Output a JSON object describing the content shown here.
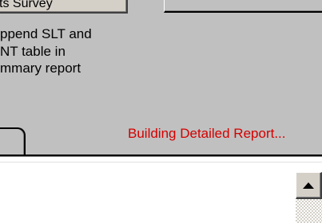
{
  "dialog": {
    "top_button_label": "ts Survey",
    "checkbox_label": "ppend SLT and\nNT table in\nmmary report",
    "status_message": "Building Detailed Report..."
  },
  "scrollbar": {
    "up_icon": "triangle-up-icon"
  },
  "colors": {
    "dialog_background": "#c0c0c0",
    "status_text": "#d40000",
    "content_background": "#ffffff"
  }
}
